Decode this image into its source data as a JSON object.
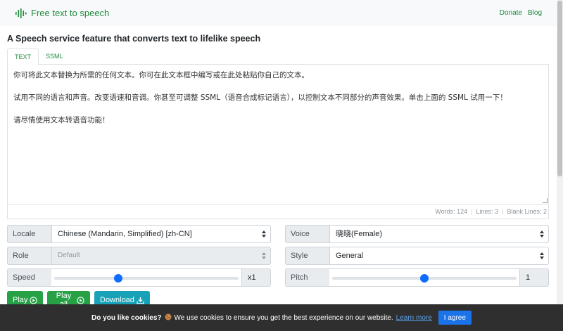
{
  "header": {
    "brand": "Free text to speech",
    "links": [
      "Donate",
      "Blog"
    ]
  },
  "main": {
    "title": "A Speech service feature that converts text to lifelike speech",
    "tabs": [
      {
        "label": "TEXT",
        "active": true
      },
      {
        "label": "SSML",
        "active": false
      }
    ],
    "editor": {
      "paragraphs": [
        "你可将此文本替换为所需的任何文本。你可在此文本框中编写或在此处粘贴你自己的文本。",
        "试用不同的语言和声音。改变语速和音调。你甚至可调整 SSML（语音合成标记语言），以控制文本不同部分的声音效果。单击上面的 SSML 试用一下！",
        "请尽情使用文本转语音功能！"
      ]
    },
    "stats": {
      "words_label": "Words:",
      "words": "124",
      "lines_label": "Lines:",
      "lines": "3",
      "blank_label": "Blank Lines:",
      "blank": "2"
    }
  },
  "controls": {
    "locale": {
      "label": "Locale",
      "value": "Chinese (Mandarin, Simplified) [zh-CN]"
    },
    "voice": {
      "label": "Voice",
      "value": "晓晓(Female)"
    },
    "role": {
      "label": "Role",
      "value": "Default",
      "disabled": true
    },
    "style": {
      "label": "Style",
      "value": "General"
    },
    "speed": {
      "label": "Speed",
      "value": "x1",
      "level": 0.34
    },
    "pitch": {
      "label": "Pitch",
      "value": "1",
      "level": 0.5
    }
  },
  "buttons": {
    "play": "Play",
    "play_all": "Play all",
    "download": "Download"
  },
  "cookie": {
    "question": "Do you like cookies?",
    "message": "We use cookies to ensure you get the best experience on our website.",
    "learn_more": "Learn more",
    "agree": "I agree"
  },
  "colors": {
    "brand_green": "#1e8a3c",
    "button_green": "#26a146",
    "button_cyan": "#17a2b8",
    "slider_blue": "#0d6efd",
    "cookie_bg": "#2f2f2f",
    "agree_blue": "#1a73e8"
  },
  "icons": [
    "waveform-icon",
    "play-circle-icon",
    "download-icon",
    "cookie-icon"
  ]
}
